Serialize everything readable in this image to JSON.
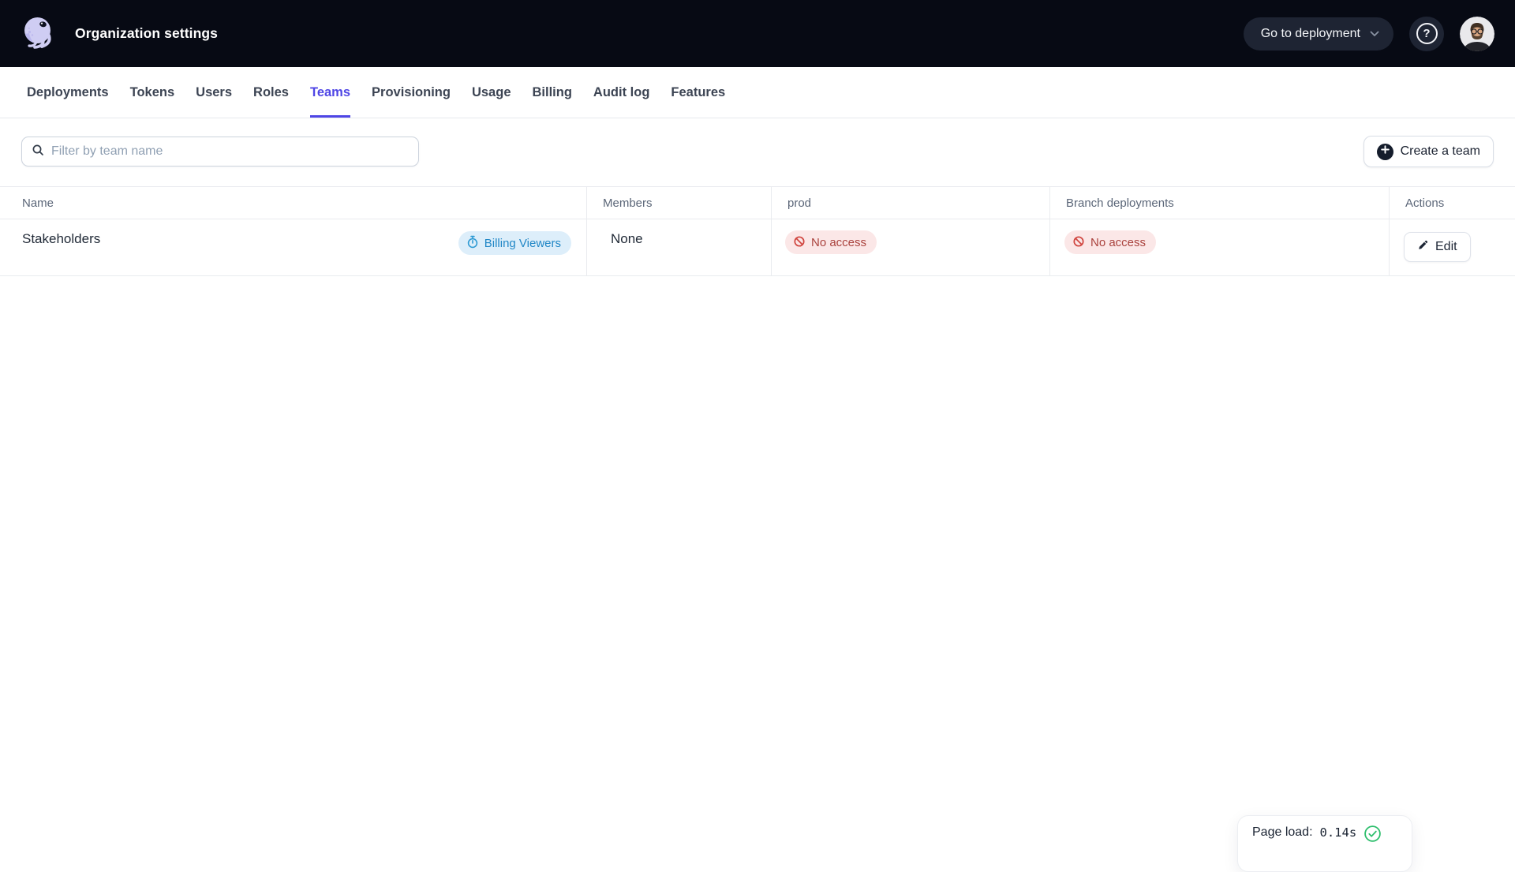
{
  "header": {
    "title": "Organization settings",
    "go_to_deployment_label": "Go to deployment",
    "help_glyph": "?"
  },
  "nav": {
    "tabs": [
      {
        "label": "Deployments",
        "active": false
      },
      {
        "label": "Tokens",
        "active": false
      },
      {
        "label": "Users",
        "active": false
      },
      {
        "label": "Roles",
        "active": false
      },
      {
        "label": "Teams",
        "active": true
      },
      {
        "label": "Provisioning",
        "active": false
      },
      {
        "label": "Usage",
        "active": false
      },
      {
        "label": "Billing",
        "active": false
      },
      {
        "label": "Audit log",
        "active": false
      },
      {
        "label": "Features",
        "active": false
      }
    ]
  },
  "toolbar": {
    "filter_placeholder": "Filter by team name",
    "create_team_label": "Create a team"
  },
  "table": {
    "columns": [
      "Name",
      "Members",
      "prod",
      "Branch deployments",
      "Actions"
    ],
    "rows": [
      {
        "name": "Stakeholders",
        "role_badge": "Billing Viewers",
        "members": "None",
        "prod_access": "No access",
        "branch_access": "No access",
        "edit_label": "Edit"
      }
    ]
  },
  "footer": {
    "page_load_label": "Page load:",
    "page_load_value": "0.14s"
  },
  "icons": {
    "logo": "octopus-logo-icon",
    "search": "search-icon",
    "plus": "plus-circle-icon",
    "timer": "stopwatch-icon",
    "no_access": "no-entry-icon",
    "edit": "pencil-icon",
    "check": "check-circle-icon",
    "chevron": "chevron-down-icon",
    "help": "question-mark-icon"
  },
  "colors": {
    "header_bg": "#070a14",
    "accent": "#4f46e5",
    "badge_blue_bg": "#ddeefa",
    "badge_blue_text": "#2187c6",
    "badge_red_bg": "#fbe7e7",
    "badge_red_text": "#aa423d",
    "success_green": "#2dbe6c"
  }
}
